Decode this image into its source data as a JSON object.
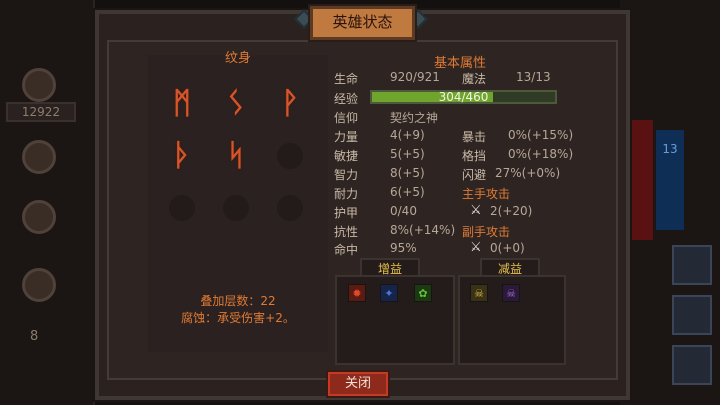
{
  "window": {
    "title": "英雄状态"
  },
  "background": {
    "gold_amount": "12922",
    "side_number": "8",
    "right_blue_number": "13"
  },
  "tattoo": {
    "title": "纹身",
    "runes": [
      "ᛗ",
      "ᛊ",
      "ᚹ",
      "ᚦ",
      "ᛋ"
    ],
    "stack_label": "叠加层数：22",
    "corrosion_label": "腐蚀：承受伤害+2。"
  },
  "attributes": {
    "title": "基本属性",
    "hp_label": "生命",
    "hp_value": "920/921",
    "mp_label": "魔法",
    "mp_value": "13/13",
    "xp_label": "经验",
    "xp_value": "304/460",
    "xp_fraction": 0.66,
    "faith_label": "信仰",
    "faith_value": "契约之神",
    "str_label": "力量",
    "str_value": "4(+9)",
    "crit_label": "暴击",
    "crit_value": "0%(+15%)",
    "agi_label": "敏捷",
    "agi_value": "5(+5)",
    "block_label": "格挡",
    "block_value": "0%(+18%)",
    "int_label": "智力",
    "int_value": "8(+5)",
    "dodge_label": "闪避",
    "dodge_value": "27%(+0%)",
    "sta_label": "耐力",
    "sta_value": "6(+5)",
    "mainhand_label": "主手攻击",
    "armor_label": "护甲",
    "armor_value": "0/40",
    "mainhand_value": "2(+20)",
    "resist_label": "抗性",
    "resist_value": "8%(+14%)",
    "offhand_label": "副手攻击",
    "hit_label": "命中",
    "hit_value": "95%",
    "offhand_value": "0(+0)"
  },
  "buffs": {
    "title": "增益",
    "icons": [
      "red-spider-icon",
      "blue-beetle-icon",
      "green-blob-icon"
    ]
  },
  "debuffs": {
    "title": "减益",
    "icons": [
      "yellow-skull-icon",
      "purple-skull-icon"
    ]
  },
  "close_label": "关闭",
  "colors": {
    "accent": "#e07a34",
    "xp_green": "#6fa52c",
    "close_red": "#8d2a1c"
  }
}
